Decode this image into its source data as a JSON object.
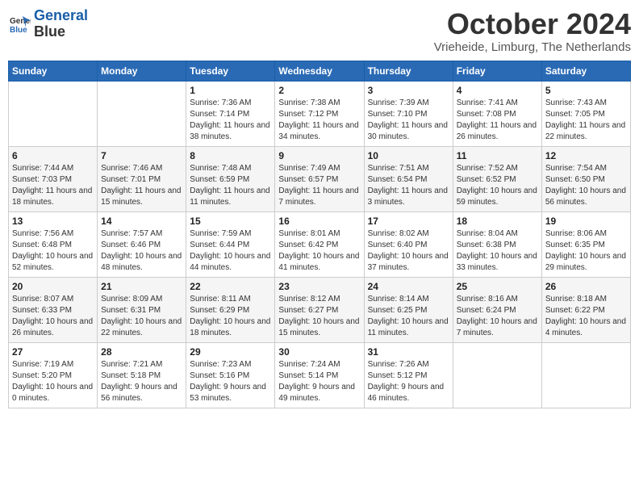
{
  "header": {
    "logo_line1": "General",
    "logo_line2": "Blue",
    "month": "October 2024",
    "location": "Vrieheide, Limburg, The Netherlands"
  },
  "weekdays": [
    "Sunday",
    "Monday",
    "Tuesday",
    "Wednesday",
    "Thursday",
    "Friday",
    "Saturday"
  ],
  "weeks": [
    [
      {
        "num": "",
        "info": ""
      },
      {
        "num": "",
        "info": ""
      },
      {
        "num": "1",
        "info": "Sunrise: 7:36 AM\nSunset: 7:14 PM\nDaylight: 11 hours and 38 minutes."
      },
      {
        "num": "2",
        "info": "Sunrise: 7:38 AM\nSunset: 7:12 PM\nDaylight: 11 hours and 34 minutes."
      },
      {
        "num": "3",
        "info": "Sunrise: 7:39 AM\nSunset: 7:10 PM\nDaylight: 11 hours and 30 minutes."
      },
      {
        "num": "4",
        "info": "Sunrise: 7:41 AM\nSunset: 7:08 PM\nDaylight: 11 hours and 26 minutes."
      },
      {
        "num": "5",
        "info": "Sunrise: 7:43 AM\nSunset: 7:05 PM\nDaylight: 11 hours and 22 minutes."
      }
    ],
    [
      {
        "num": "6",
        "info": "Sunrise: 7:44 AM\nSunset: 7:03 PM\nDaylight: 11 hours and 18 minutes."
      },
      {
        "num": "7",
        "info": "Sunrise: 7:46 AM\nSunset: 7:01 PM\nDaylight: 11 hours and 15 minutes."
      },
      {
        "num": "8",
        "info": "Sunrise: 7:48 AM\nSunset: 6:59 PM\nDaylight: 11 hours and 11 minutes."
      },
      {
        "num": "9",
        "info": "Sunrise: 7:49 AM\nSunset: 6:57 PM\nDaylight: 11 hours and 7 minutes."
      },
      {
        "num": "10",
        "info": "Sunrise: 7:51 AM\nSunset: 6:54 PM\nDaylight: 11 hours and 3 minutes."
      },
      {
        "num": "11",
        "info": "Sunrise: 7:52 AM\nSunset: 6:52 PM\nDaylight: 10 hours and 59 minutes."
      },
      {
        "num": "12",
        "info": "Sunrise: 7:54 AM\nSunset: 6:50 PM\nDaylight: 10 hours and 56 minutes."
      }
    ],
    [
      {
        "num": "13",
        "info": "Sunrise: 7:56 AM\nSunset: 6:48 PM\nDaylight: 10 hours and 52 minutes."
      },
      {
        "num": "14",
        "info": "Sunrise: 7:57 AM\nSunset: 6:46 PM\nDaylight: 10 hours and 48 minutes."
      },
      {
        "num": "15",
        "info": "Sunrise: 7:59 AM\nSunset: 6:44 PM\nDaylight: 10 hours and 44 minutes."
      },
      {
        "num": "16",
        "info": "Sunrise: 8:01 AM\nSunset: 6:42 PM\nDaylight: 10 hours and 41 minutes."
      },
      {
        "num": "17",
        "info": "Sunrise: 8:02 AM\nSunset: 6:40 PM\nDaylight: 10 hours and 37 minutes."
      },
      {
        "num": "18",
        "info": "Sunrise: 8:04 AM\nSunset: 6:38 PM\nDaylight: 10 hours and 33 minutes."
      },
      {
        "num": "19",
        "info": "Sunrise: 8:06 AM\nSunset: 6:35 PM\nDaylight: 10 hours and 29 minutes."
      }
    ],
    [
      {
        "num": "20",
        "info": "Sunrise: 8:07 AM\nSunset: 6:33 PM\nDaylight: 10 hours and 26 minutes."
      },
      {
        "num": "21",
        "info": "Sunrise: 8:09 AM\nSunset: 6:31 PM\nDaylight: 10 hours and 22 minutes."
      },
      {
        "num": "22",
        "info": "Sunrise: 8:11 AM\nSunset: 6:29 PM\nDaylight: 10 hours and 18 minutes."
      },
      {
        "num": "23",
        "info": "Sunrise: 8:12 AM\nSunset: 6:27 PM\nDaylight: 10 hours and 15 minutes."
      },
      {
        "num": "24",
        "info": "Sunrise: 8:14 AM\nSunset: 6:25 PM\nDaylight: 10 hours and 11 minutes."
      },
      {
        "num": "25",
        "info": "Sunrise: 8:16 AM\nSunset: 6:24 PM\nDaylight: 10 hours and 7 minutes."
      },
      {
        "num": "26",
        "info": "Sunrise: 8:18 AM\nSunset: 6:22 PM\nDaylight: 10 hours and 4 minutes."
      }
    ],
    [
      {
        "num": "27",
        "info": "Sunrise: 7:19 AM\nSunset: 5:20 PM\nDaylight: 10 hours and 0 minutes."
      },
      {
        "num": "28",
        "info": "Sunrise: 7:21 AM\nSunset: 5:18 PM\nDaylight: 9 hours and 56 minutes."
      },
      {
        "num": "29",
        "info": "Sunrise: 7:23 AM\nSunset: 5:16 PM\nDaylight: 9 hours and 53 minutes."
      },
      {
        "num": "30",
        "info": "Sunrise: 7:24 AM\nSunset: 5:14 PM\nDaylight: 9 hours and 49 minutes."
      },
      {
        "num": "31",
        "info": "Sunrise: 7:26 AM\nSunset: 5:12 PM\nDaylight: 9 hours and 46 minutes."
      },
      {
        "num": "",
        "info": ""
      },
      {
        "num": "",
        "info": ""
      }
    ]
  ]
}
